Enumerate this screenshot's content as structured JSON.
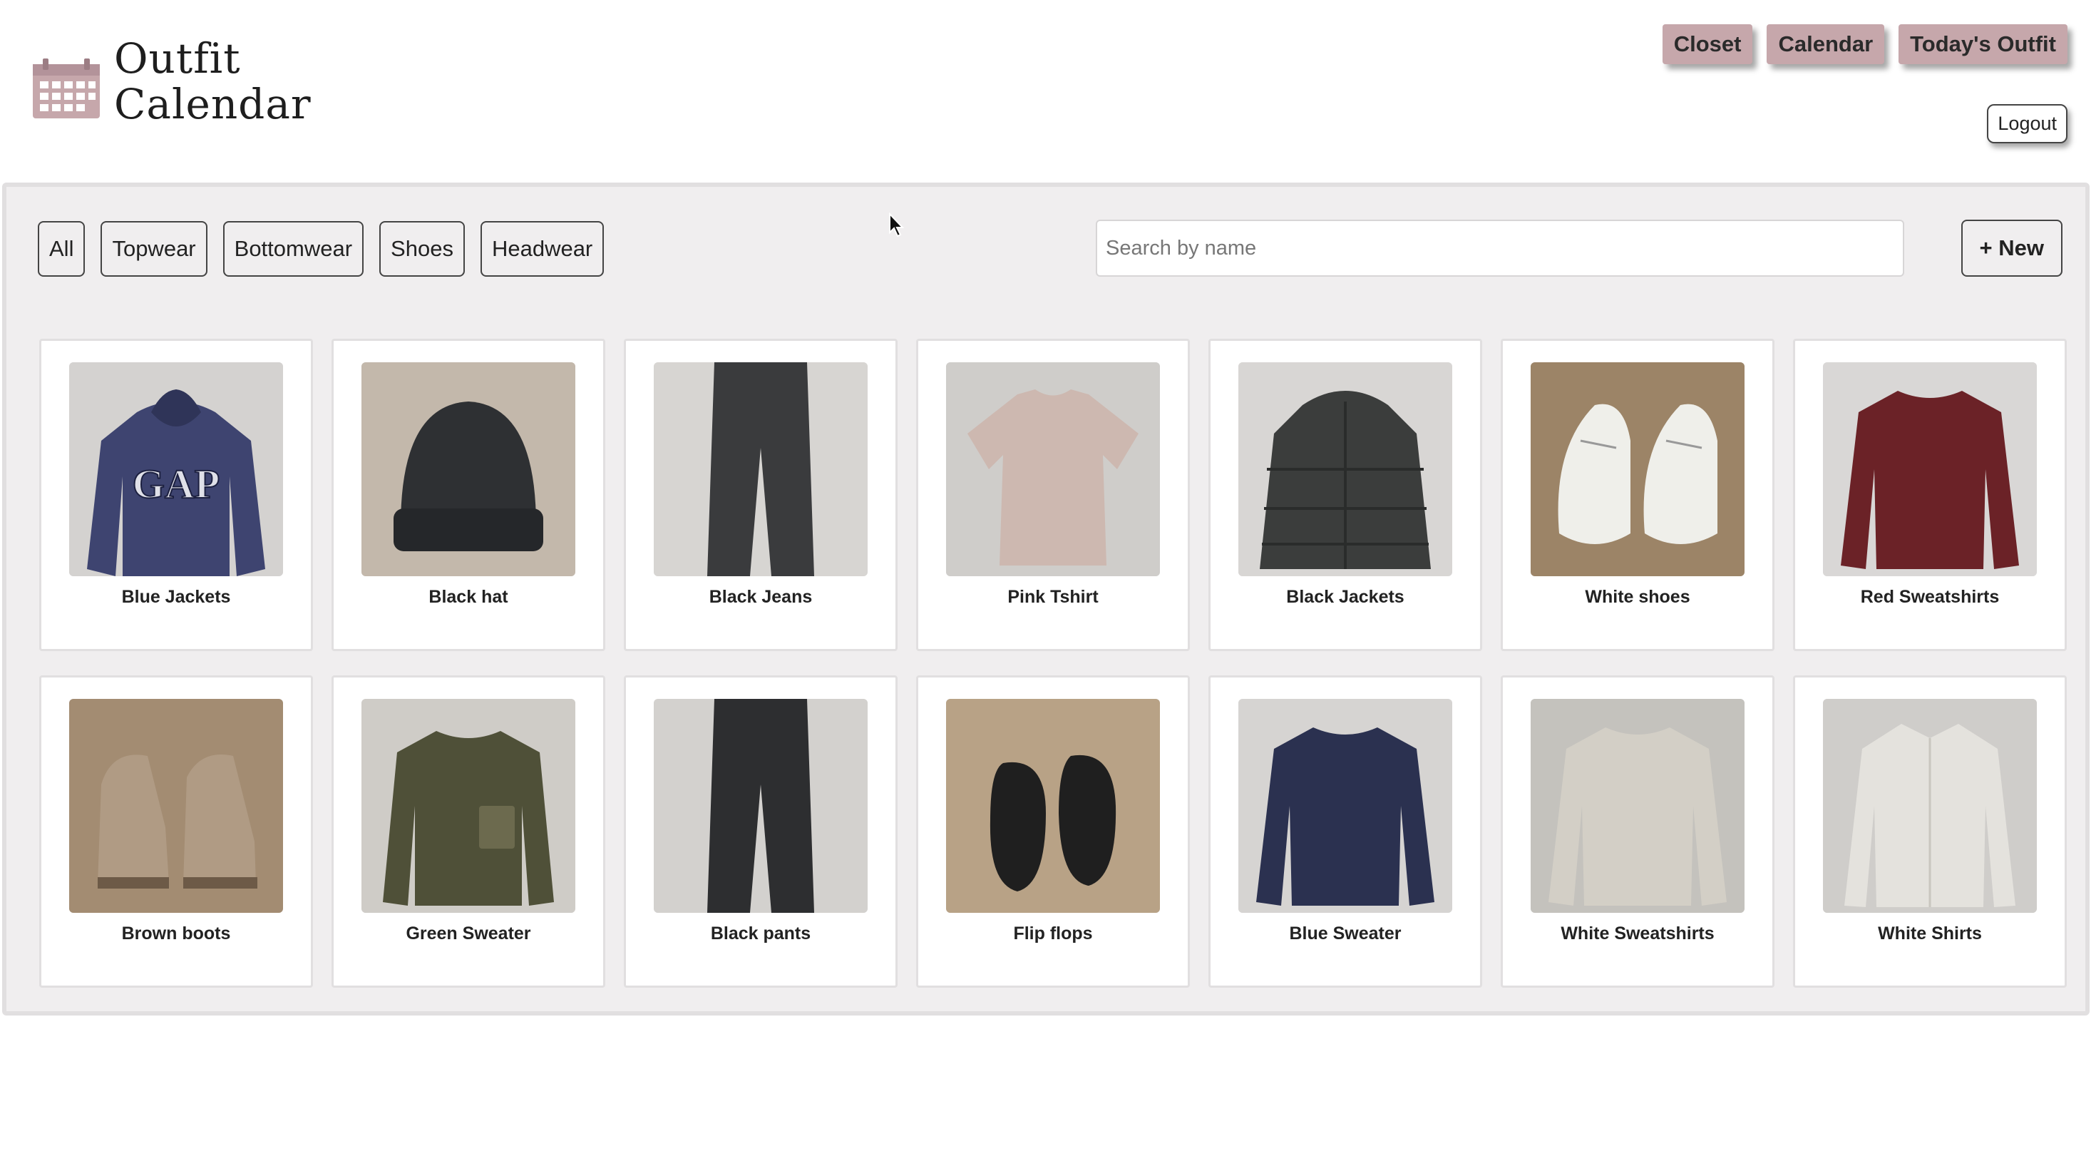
{
  "app": {
    "title_line1": "Outfit",
    "title_line2": "Calendar"
  },
  "nav": {
    "closet": "Closet",
    "calendar": "Calendar",
    "todays_outfit": "Today's Outfit",
    "logout": "Logout"
  },
  "filters": [
    "All",
    "Topwear",
    "Bottomwear",
    "Shoes",
    "Headwear"
  ],
  "search": {
    "placeholder": "Search by name",
    "value": ""
  },
  "new_button": "+ New",
  "colors": {
    "accent": "#c6a7ab",
    "panel": "#f0eeef"
  },
  "items": [
    {
      "name": "Blue Jackets",
      "kind": "hoodie",
      "color": "#3e4470",
      "bg": "#d4d2d0"
    },
    {
      "name": "Black hat",
      "kind": "beanie",
      "color": "#2e3033",
      "bg": "#c3b8ab"
    },
    {
      "name": "Black Jeans",
      "kind": "pants",
      "color": "#3a3b3d",
      "bg": "#d7d5d2"
    },
    {
      "name": "Pink Tshirt",
      "kind": "tshirt",
      "color": "#cdb8b0",
      "bg": "#cfcdca"
    },
    {
      "name": "Black Jackets",
      "kind": "puffer",
      "color": "#3b3d3c",
      "bg": "#d8d6d4"
    },
    {
      "name": "White shoes",
      "kind": "sneakers",
      "color": "#efefea",
      "bg": "#9c8467"
    },
    {
      "name": "Red Sweatshirts",
      "kind": "sweater",
      "color": "#6b2227",
      "bg": "#d9d7d6"
    },
    {
      "name": "Brown boots",
      "kind": "boots",
      "color": "#b09b84",
      "bg": "#a38c72"
    },
    {
      "name": "Green Sweater",
      "kind": "fleece",
      "color": "#4f5038",
      "bg": "#cfccc7"
    },
    {
      "name": "Black pants",
      "kind": "pants",
      "color": "#2d2e30",
      "bg": "#d3d1ce"
    },
    {
      "name": "Flip flops",
      "kind": "flipflops",
      "color": "#1f1f1f",
      "bg": "#b8a286"
    },
    {
      "name": "Blue Sweater",
      "kind": "sweater",
      "color": "#2b3150",
      "bg": "#d6d4d2"
    },
    {
      "name": "White Sweatshirts",
      "kind": "sweater",
      "color": "#d3cfc6",
      "bg": "#c4c2bd"
    },
    {
      "name": "White Shirts",
      "kind": "shirt",
      "color": "#e4e2dd",
      "bg": "#cfcdca"
    }
  ]
}
